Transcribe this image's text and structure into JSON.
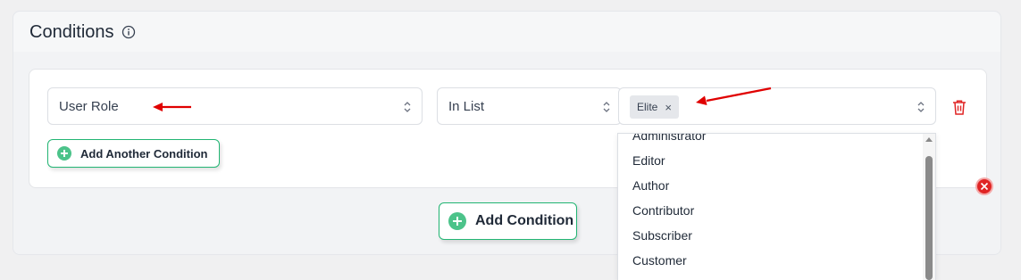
{
  "panel": {
    "title": "Conditions",
    "info_icon": "info-circle-icon"
  },
  "condition": {
    "field": {
      "value": "User Role"
    },
    "operator": {
      "value": "In List"
    },
    "values": {
      "selected_tags": [
        {
          "label": "Elite",
          "remove_glyph": "×"
        }
      ]
    },
    "delete_icon": "trash-icon",
    "add_another_label": "Add Another Condition",
    "remove_group_icon": "close-circle-icon"
  },
  "add_condition_label": "Add Condition",
  "dropdown": {
    "options": [
      "Administrator",
      "Editor",
      "Author",
      "Contributor",
      "Subscriber",
      "Customer"
    ]
  },
  "colors": {
    "accent_green": "#22b573",
    "plus_green": "#4cc38a",
    "danger_red": "#e02424",
    "annotation_arrow": "#e00000"
  }
}
